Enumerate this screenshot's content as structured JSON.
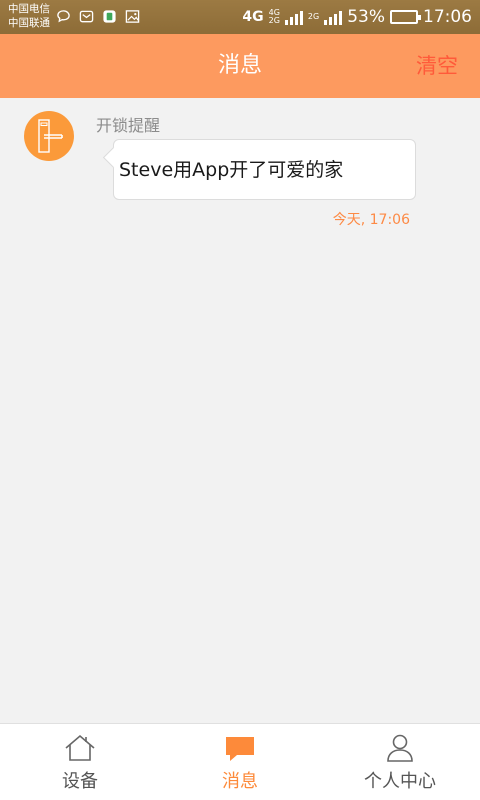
{
  "status_bar": {
    "carrier_1": "中国电信",
    "carrier_2": "中国联通",
    "network_1": "4G",
    "network_2_top": "4G",
    "network_2_bottom": "2G",
    "network_3": "2G",
    "battery_percent": "53%",
    "battery_level": 0.53,
    "time": "17:06"
  },
  "header": {
    "title": "消息",
    "clear_label": "清空"
  },
  "messages": [
    {
      "title": "开锁提醒",
      "text": "Steve用App开了可爱的家",
      "time": "今天, 17:06"
    }
  ],
  "tabs": [
    {
      "label": "设备",
      "icon": "home-icon"
    },
    {
      "label": "消息",
      "icon": "message-icon",
      "active": true
    },
    {
      "label": "个人中心",
      "icon": "person-icon"
    }
  ],
  "colors": {
    "header_bg": "#fd9a5f",
    "accent": "#fd8a3a",
    "clear_text": "#ff5a3a",
    "status_bar": "#9c7a43"
  }
}
